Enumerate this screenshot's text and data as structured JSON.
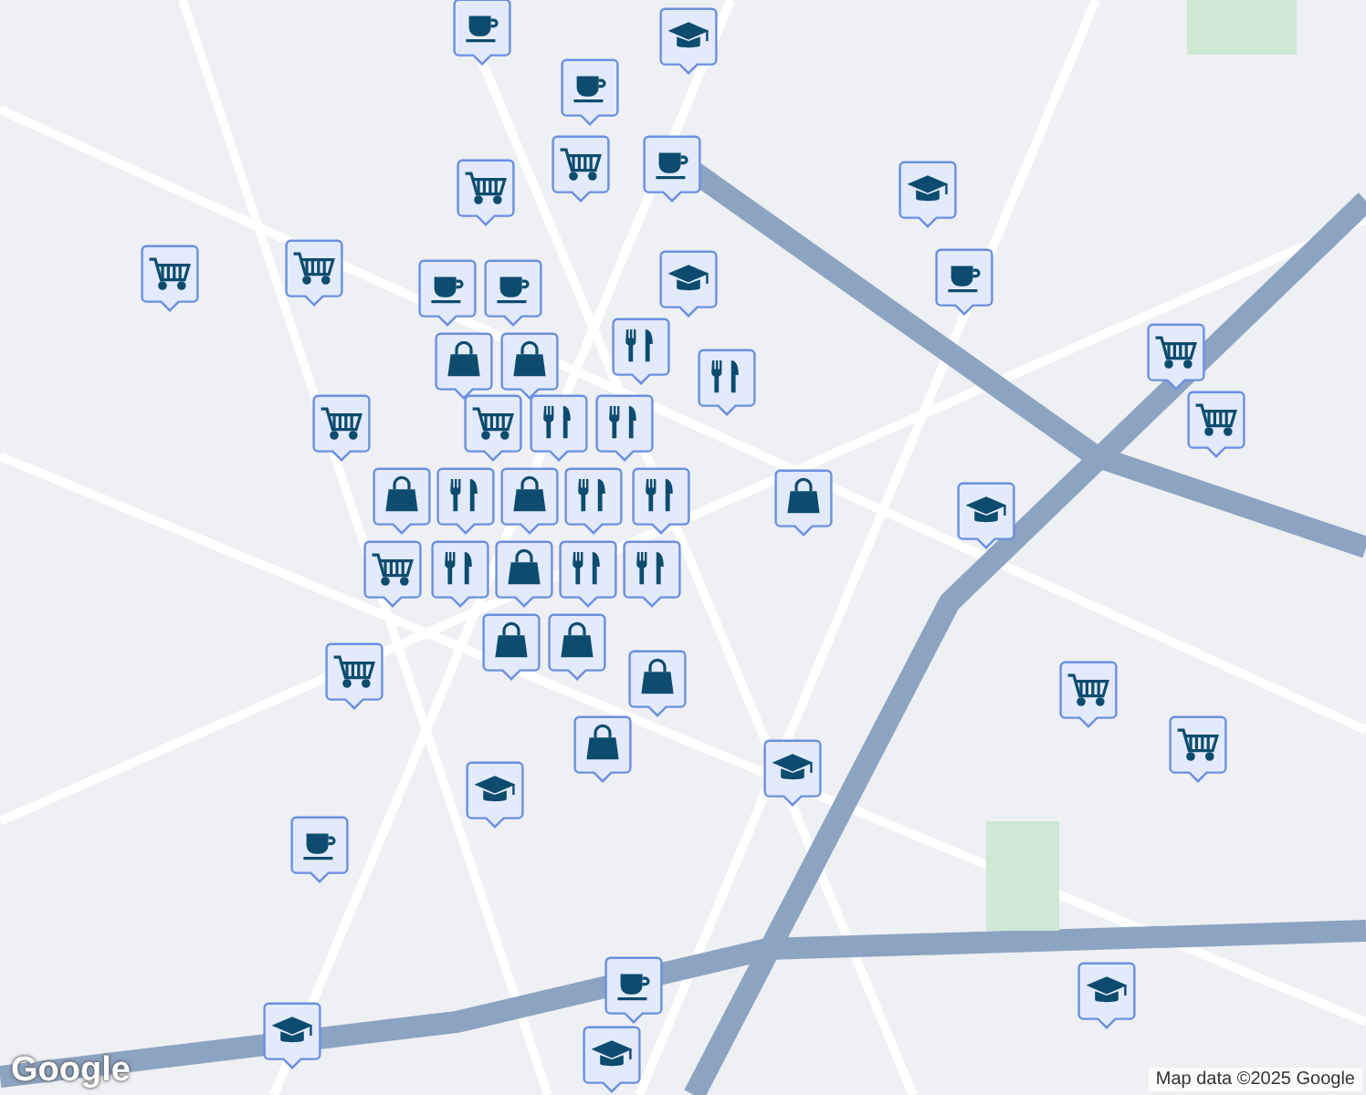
{
  "map": {
    "pins": [
      {
        "kind": "cafe"
      },
      {
        "kind": "school"
      },
      {
        "kind": "cafe"
      },
      {
        "kind": "cart"
      },
      {
        "kind": "cafe"
      },
      {
        "kind": "cart"
      },
      {
        "kind": "school"
      },
      {
        "kind": "cart"
      },
      {
        "kind": "cart"
      },
      {
        "kind": "school"
      },
      {
        "kind": "cafe"
      },
      {
        "kind": "cafe"
      },
      {
        "kind": "cafe"
      },
      {
        "kind": "shopping"
      },
      {
        "kind": "shopping"
      },
      {
        "kind": "restaurant"
      },
      {
        "kind": "restaurant"
      },
      {
        "kind": "cart"
      },
      {
        "kind": "cart"
      },
      {
        "kind": "cart"
      },
      {
        "kind": "cart"
      },
      {
        "kind": "restaurant"
      },
      {
        "kind": "restaurant"
      },
      {
        "kind": "shopping"
      },
      {
        "kind": "restaurant"
      },
      {
        "kind": "school"
      },
      {
        "kind": "shopping"
      },
      {
        "kind": "restaurant"
      },
      {
        "kind": "restaurant"
      },
      {
        "kind": "shopping"
      },
      {
        "kind": "restaurant"
      },
      {
        "kind": "shopping"
      },
      {
        "kind": "restaurant"
      },
      {
        "kind": "restaurant"
      },
      {
        "kind": "cart"
      },
      {
        "kind": "shopping"
      },
      {
        "kind": "shopping"
      },
      {
        "kind": "shopping"
      },
      {
        "kind": "cart"
      },
      {
        "kind": "cart"
      },
      {
        "kind": "cart"
      },
      {
        "kind": "shopping"
      },
      {
        "kind": "school"
      },
      {
        "kind": "school"
      },
      {
        "kind": "cafe"
      },
      {
        "kind": "school"
      },
      {
        "kind": "school"
      },
      {
        "kind": "cafe"
      },
      {
        "kind": "school"
      }
    ]
  },
  "logo": "Google",
  "attribution": "Map data ©2025 Google"
}
